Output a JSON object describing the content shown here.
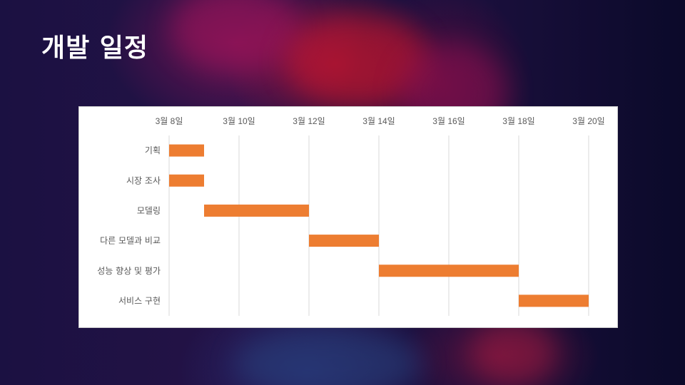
{
  "slide": {
    "title": "개발 일정"
  },
  "colors": {
    "bar": "#ed7d31",
    "grid": "#d9d9d9",
    "label": "#595959",
    "panel": "#ffffff"
  },
  "chart_data": {
    "type": "bar",
    "orientation": "horizontal-gantt",
    "title": "",
    "x_ticks": [
      "3월 8일",
      "3월 10일",
      "3월 12일",
      "3월 14일",
      "3월 16일",
      "3월 18일",
      "3월 20일"
    ],
    "xlim": [
      "03-08",
      "03-20"
    ],
    "x_axis_position": "top",
    "grid": true,
    "categories": [
      "기획",
      "시장 조사",
      "모델링",
      "다른 모델과 비교",
      "성능 향상 및 평가",
      "서비스 구현"
    ],
    "tasks": [
      {
        "name": "기획",
        "start": "03-08",
        "end": "03-09"
      },
      {
        "name": "시장 조사",
        "start": "03-08",
        "end": "03-09"
      },
      {
        "name": "모델링",
        "start": "03-09",
        "end": "03-12"
      },
      {
        "name": "다른 모델과 비교",
        "start": "03-12",
        "end": "03-14"
      },
      {
        "name": "성능 향상 및 평가",
        "start": "03-14",
        "end": "03-18"
      },
      {
        "name": "서비스 구현",
        "start": "03-18",
        "end": "03-20"
      }
    ]
  }
}
